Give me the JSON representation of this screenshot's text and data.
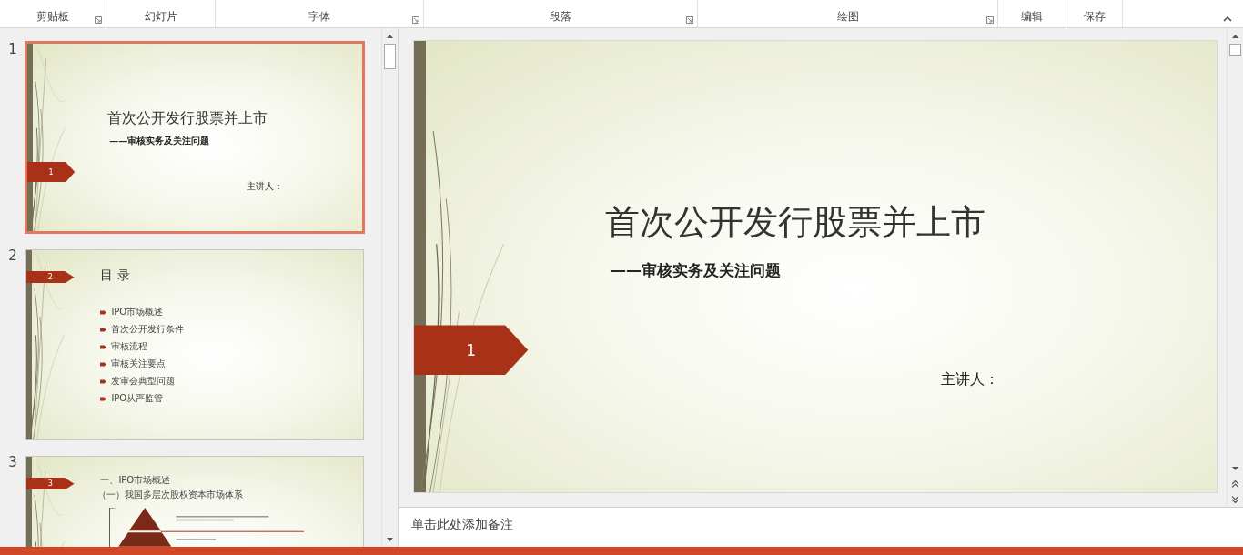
{
  "ribbon": {
    "groups": [
      {
        "label": "剪贴板",
        "launcher": true
      },
      {
        "label": "幻灯片",
        "launcher": false
      },
      {
        "label": "字体",
        "launcher": true
      },
      {
        "label": "段落",
        "launcher": true
      },
      {
        "label": "绘图",
        "launcher": true
      },
      {
        "label": "编辑",
        "launcher": false
      },
      {
        "label": "保存",
        "launcher": false
      }
    ]
  },
  "slides": [
    {
      "number": "1",
      "selected": true,
      "kind": "title",
      "tag": "1",
      "title": "首次公开发行股票并上市",
      "subtitle": "——审核实务及关注问题",
      "presenter": "主讲人："
    },
    {
      "number": "2",
      "selected": false,
      "kind": "toc",
      "tag": "2",
      "title": "目 录",
      "items": [
        "IPO市场概述",
        "首次公开发行条件",
        "审核流程",
        "审核关注要点",
        "发审会典型问题",
        "IPO从严监管"
      ]
    },
    {
      "number": "3",
      "selected": false,
      "kind": "section",
      "tag": "3",
      "heading": "一、IPO市场概述",
      "subheading": "（一）我国多层次股权资本市场体系"
    }
  ],
  "editor": {
    "tag": "1",
    "title": "首次公开发行股票并上市",
    "subtitle": "——审核实务及关注问题",
    "presenter": "主讲人："
  },
  "notes": {
    "placeholder": "单击此处添加备注"
  }
}
